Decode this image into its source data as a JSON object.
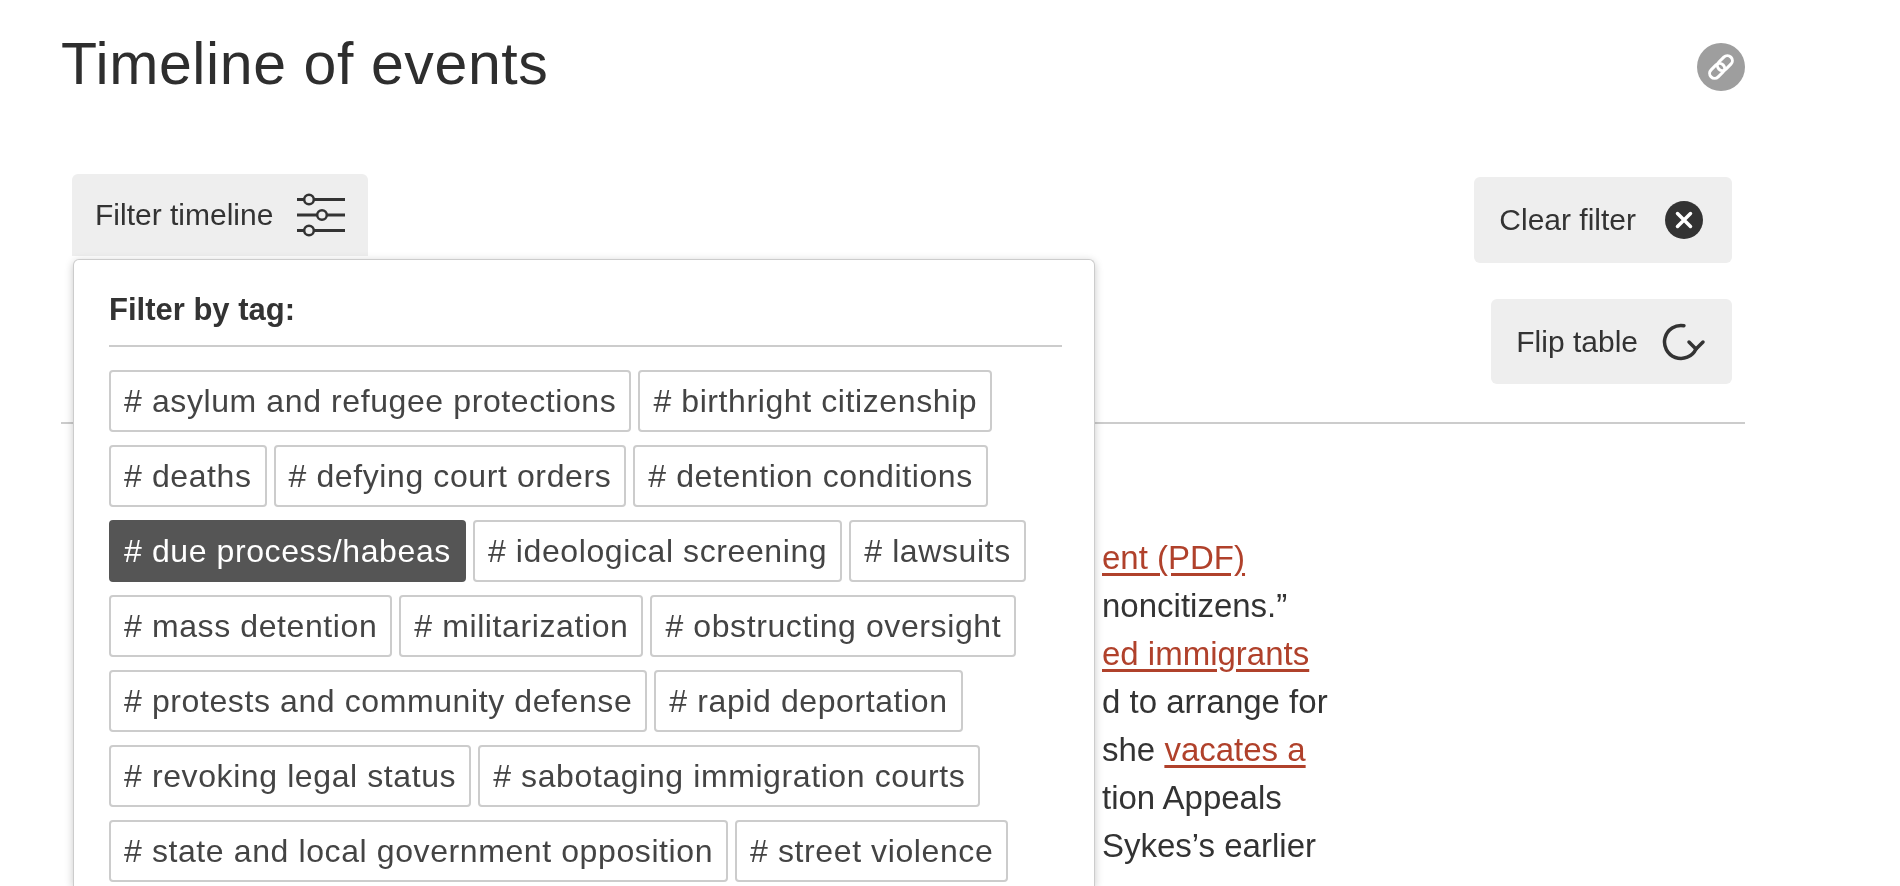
{
  "page": {
    "title": "Timeline of events"
  },
  "filter_button": {
    "label": "Filter timeline",
    "expanded": true
  },
  "filter_panel": {
    "heading": "Filter by tag:",
    "tags": [
      {
        "label": "# asylum and refugee protections",
        "selected": false
      },
      {
        "label": "# birthright citizenship",
        "selected": false
      },
      {
        "label": "# deaths",
        "selected": false
      },
      {
        "label": "# defying court orders",
        "selected": false
      },
      {
        "label": "# detention conditions",
        "selected": false
      },
      {
        "label": "# due process/habeas",
        "selected": true
      },
      {
        "label": "# ideological screening",
        "selected": false
      },
      {
        "label": "# lawsuits",
        "selected": false
      },
      {
        "label": "# mass detention",
        "selected": false
      },
      {
        "label": "# militarization",
        "selected": false
      },
      {
        "label": "# obstructing oversight",
        "selected": false
      },
      {
        "label": "# protests and community defense",
        "selected": false
      },
      {
        "label": "# rapid deportation",
        "selected": false
      },
      {
        "label": "# revoking legal status",
        "selected": false
      },
      {
        "label": "# sabotaging immigration courts",
        "selected": false
      },
      {
        "label": "# state and local government opposition",
        "selected": false
      },
      {
        "label": "# street violence",
        "selected": false
      }
    ]
  },
  "actions": [
    {
      "kind": "clear",
      "label": "Clear filter"
    },
    {
      "kind": "flip",
      "label": "Flip table"
    }
  ],
  "article_fragment": {
    "lines": [
      [
        {
          "kind": "link",
          "text": "ent (PDF)"
        }
      ],
      [
        {
          "kind": "text",
          "text": "noncitizens.”"
        }
      ],
      [
        {
          "kind": "link",
          "text": "ed immigrants"
        }
      ],
      [
        {
          "kind": "text",
          "text": "d to arrange for"
        }
      ],
      [
        {
          "kind": "text",
          "text": "she"
        },
        {
          "kind": "link",
          "text": "vacates a"
        }
      ],
      [
        {
          "kind": "text",
          "text": "tion Appeals"
        }
      ],
      [
        {
          "kind": "text",
          "text": "Sykes’s earlier"
        }
      ]
    ]
  }
}
